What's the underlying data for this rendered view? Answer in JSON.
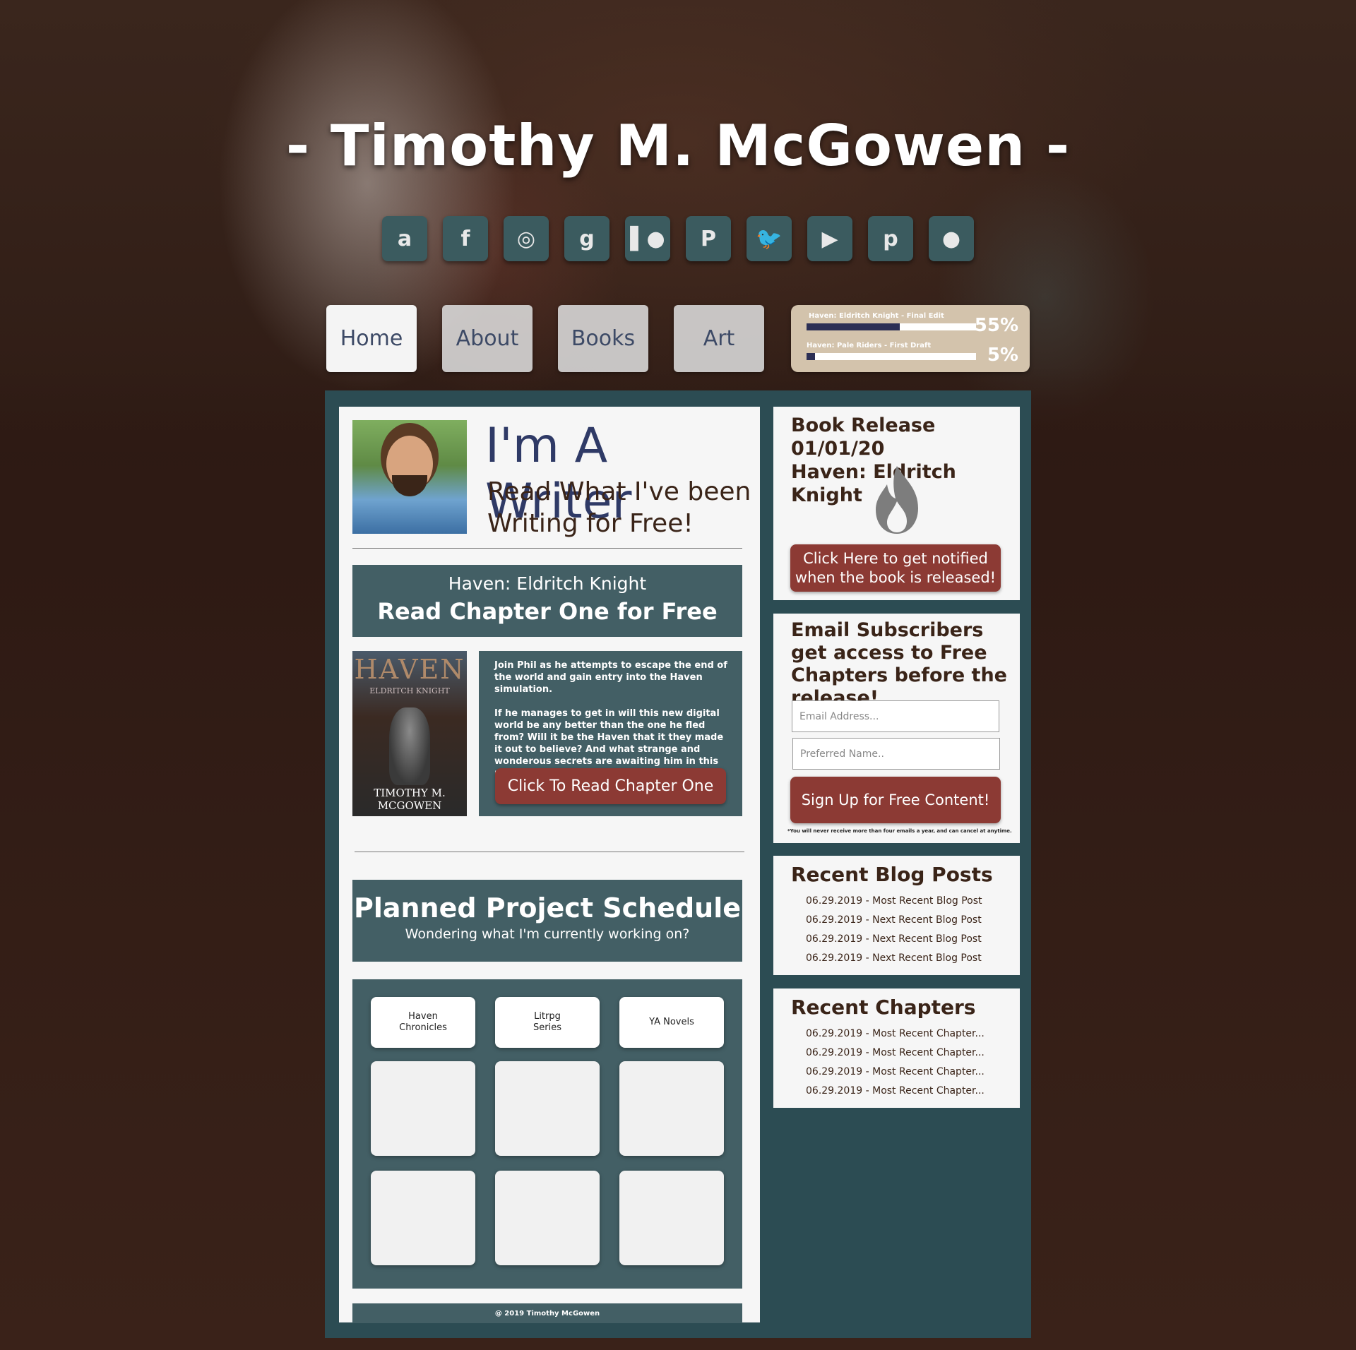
{
  "header": {
    "site_title": "- Timothy M. McGowen -",
    "social_icons": [
      {
        "name": "amazon-icon",
        "glyph": "a"
      },
      {
        "name": "facebook-icon",
        "glyph": "f"
      },
      {
        "name": "instagram-icon",
        "glyph": "◎"
      },
      {
        "name": "goodreads-icon",
        "glyph": "g"
      },
      {
        "name": "patreon-icon",
        "glyph": "▌●"
      },
      {
        "name": "paypal-icon",
        "glyph": "P"
      },
      {
        "name": "twitter-icon",
        "glyph": "🐦"
      },
      {
        "name": "youtube-icon",
        "glyph": "▶"
      },
      {
        "name": "pinterest-icon",
        "glyph": "p"
      },
      {
        "name": "reddit-icon",
        "glyph": "●"
      }
    ]
  },
  "nav": {
    "items": [
      "Home",
      "About",
      "Books",
      "Art"
    ],
    "active": "Home"
  },
  "progress": [
    {
      "label": "Haven: Eldritch Knight - Final Edit",
      "percent": 55,
      "percent_text": "55%"
    },
    {
      "label": "Haven: Pale Riders - First Draft",
      "percent": 5,
      "percent_text": "5%"
    }
  ],
  "intro": {
    "title": "I'm A Writer",
    "subtitle": "Read What I've been Writing for Free!"
  },
  "chapter_promo": {
    "book": "Haven: Eldritch Knight",
    "cta_title": "Read Chapter One for Free",
    "cover_title": "HAVEN",
    "cover_subtitle": "ELDRITCH KNIGHT",
    "cover_author": "TIMOTHY M. MCGOWEN",
    "description": "Join Phil as he attempts to escape the end of the world and gain entry into the Haven simulation.\n\nIf he manages to get in will this new digital world be any better than the one he fled from? Will it be the Haven that it they made it out to believe? And what strange and wonderous secrets are awaiting him in this new world of magic and steel!",
    "read_button": "Click To Read Chapter One"
  },
  "schedule": {
    "title": "Planned Project Schedule",
    "subtitle": "Wondering what I'm currently working on?",
    "columns": [
      "Haven\nChronicles",
      "Litrpg\nSeries",
      "YA Novels"
    ]
  },
  "footer": {
    "copyright": "@ 2019 Timothy McGowen"
  },
  "release": {
    "title": "Book Release 01/01/20\nHaven: Eldritch Knight",
    "notify_button": "Click Here to get notified when the book is released!"
  },
  "subscribe": {
    "title": "Email Subscribers get access to Free Chapters before the release!",
    "email_placeholder": "Email Address...",
    "name_placeholder": "Preferred Name..",
    "button": "Sign Up for Free Content!",
    "fine_print": "*You will never receive more than four emails a year, and can cancel at anytime."
  },
  "blog": {
    "title": "Recent Blog Posts",
    "items": [
      "06.29.2019 - Most Recent Blog Post",
      "06.29.2019 - Next Recent Blog Post",
      "06.29.2019 - Next Recent Blog Post",
      "06.29.2019 - Next Recent Blog Post"
    ]
  },
  "chapters": {
    "title": "Recent Chapters",
    "items": [
      "06.29.2019 - Most Recent Chapter...",
      "06.29.2019 - Most Recent Chapter...",
      "06.29.2019 - Most Recent Chapter...",
      "06.29.2019 - Most Recent Chapter..."
    ]
  },
  "colors": {
    "panel_teal": "#2c4c53",
    "box_teal": "#435f65",
    "button_red": "#8c3a34",
    "title_navy": "#2f3a66",
    "text_brown": "#3a2418"
  }
}
